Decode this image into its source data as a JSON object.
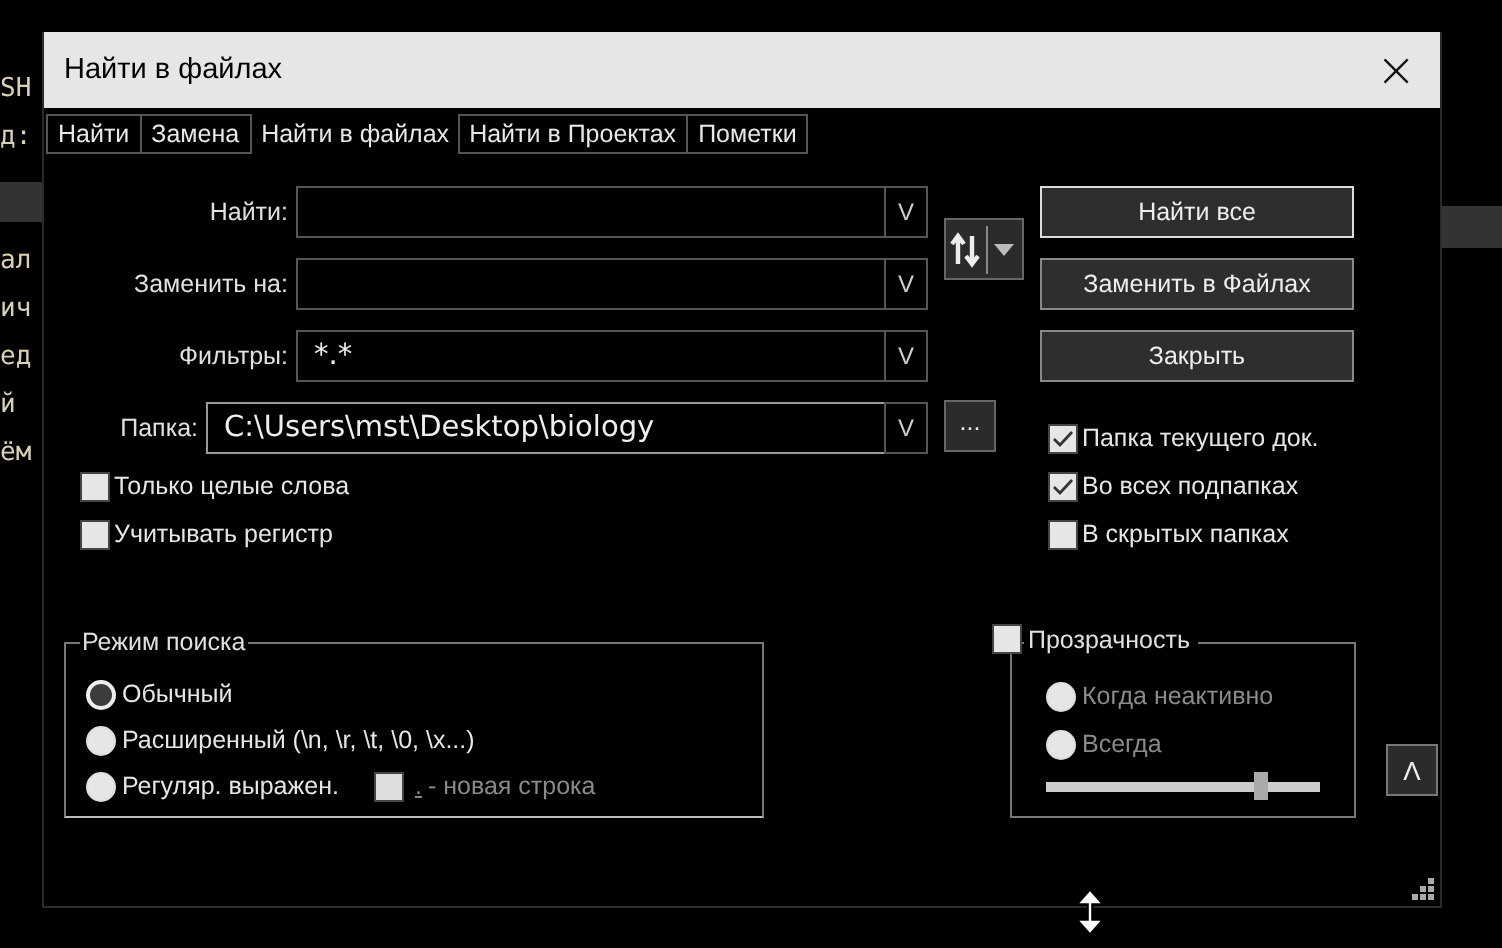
{
  "editor_background": {
    "left_lines": [
      {
        "text": "SH"
      },
      {
        "text": "д:"
      },
      {
        "kind": "highlight"
      },
      {
        "text": "ал"
      },
      {
        "text": "ич"
      },
      {
        "text": "ед"
      },
      {
        "text": "й"
      },
      {
        "text": "ём"
      }
    ]
  },
  "window": {
    "title": "Найти в файлах",
    "close": "×"
  },
  "tabs": [
    {
      "label": "Найти",
      "selected": false
    },
    {
      "label": "Замена",
      "selected": false
    },
    {
      "label": "Найти в файлах",
      "selected": true
    },
    {
      "label": "Найти в Проектах",
      "selected": false
    },
    {
      "label": "Пометки",
      "selected": false
    }
  ],
  "fields": [
    {
      "label": "Найти:",
      "dropdown": "V"
    },
    {
      "label": "Заменить на:",
      "dropdown": "V"
    },
    {
      "label": "Фильтры:",
      "value": "*.*",
      "dropdown": "V"
    }
  ],
  "folder": {
    "label": "Папка:",
    "value": "C:\\Users\\mst\\Desktop\\biology",
    "dropdown": "V",
    "browse": "...",
    "focused": true
  },
  "buttons": [
    {
      "label": "Найти все",
      "default": true
    },
    {
      "label": "Заменить в Файлах",
      "default": false
    },
    {
      "label": "Закрыть",
      "default": false
    }
  ],
  "left_options": [
    {
      "label": "Только целые слова",
      "checked": false
    },
    {
      "label": "Учитывать регистр",
      "checked": false
    }
  ],
  "folder_options": [
    {
      "label": "Папка текущего док.",
      "checked": true
    },
    {
      "label": "Во всех подпапках",
      "checked": true
    },
    {
      "label": "В скрытых папках",
      "checked": false
    }
  ],
  "search_mode": {
    "title": "Режим поиска",
    "options": [
      {
        "label": "Обычный",
        "selected": true
      },
      {
        "label": "Расширенный (\\n, \\r, \\t, \\0, \\x...)",
        "selected": false
      },
      {
        "label": "Регуляр. выражен.",
        "selected": false
      }
    ],
    "dot_newline": {
      "checked": false,
      "disabled": true,
      "dot": ".",
      "label": "- новая строка"
    }
  },
  "transparency": {
    "label": "Прозрачность",
    "checked": false,
    "options": [
      {
        "label": "Когда неактивно",
        "selected": false
      },
      {
        "label": "Всегда",
        "selected": false
      }
    ],
    "level": 0.78
  },
  "collapse_button": "Λ"
}
